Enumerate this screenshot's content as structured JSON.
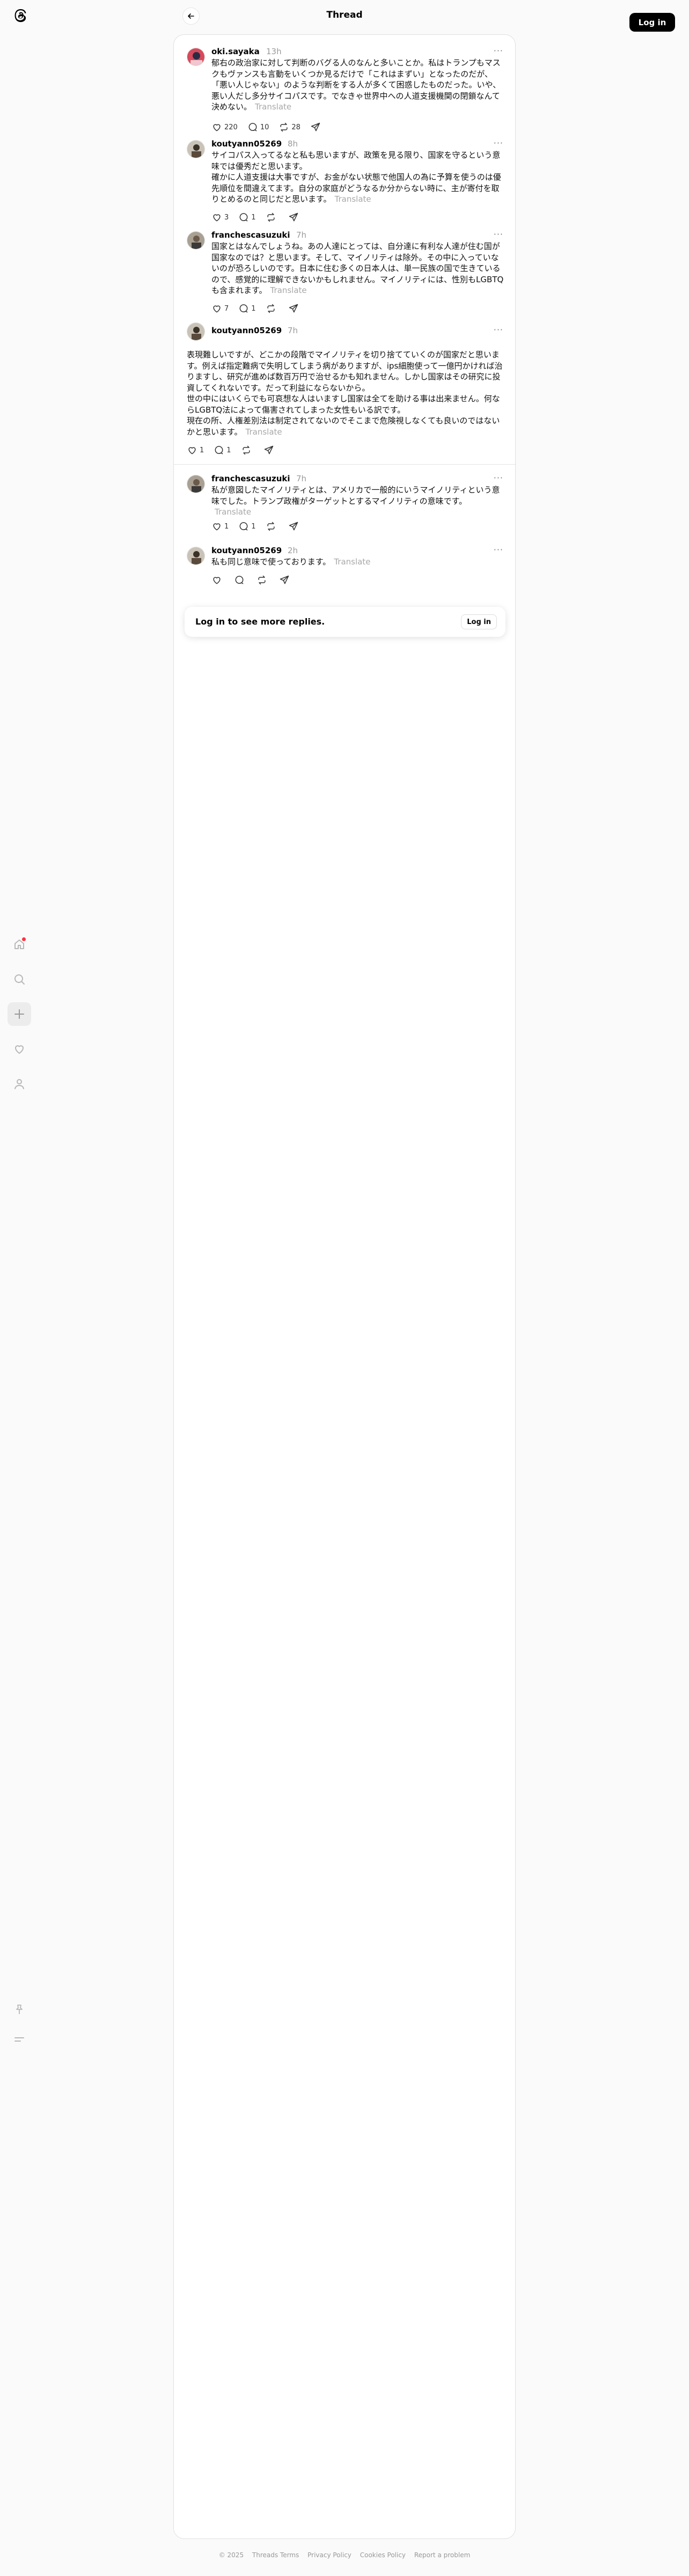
{
  "header": {
    "title": "Thread",
    "login_label": "Log in"
  },
  "nav": {
    "items": [
      {
        "name": "home"
      },
      {
        "name": "search"
      },
      {
        "name": "create"
      },
      {
        "name": "activity"
      },
      {
        "name": "profile"
      }
    ],
    "bottom": [
      {
        "name": "pin"
      },
      {
        "name": "menu"
      }
    ]
  },
  "posts": [
    {
      "username": "oki.sayaka",
      "time": "13h",
      "text": "郁右の政治家に対して判断のバグる人のなんと多いことか。私はトランプもマスクもヴァンスも言動をいくつか見るだけで「これはまずい」となったのだが、「悪い人じゃない」のような判断をする人が多くて困惑したものだった。いや、悪い人だし多分サイコパスです。でなきゃ世界中への人道支援機関の閉鎖なんて決めない。",
      "translate": "Translate",
      "likes": "220",
      "replies": "10",
      "reposts": "28"
    },
    {
      "username": "koutyann05269",
      "time": "8h",
      "text": "サイコパス入ってるなと私も思いますが、政策を見る限り、国家を守るという意味では優秀だと思います。\n確かに人道支援は大事ですが、お金がない状態で他国人の為に予算を使うのは優先順位を間違えてます。自分の家庭がどうなるか分からない時に、主が寄付を取りとめるのと同じだと思います。",
      "translate": "Translate",
      "likes": "3",
      "replies": "1",
      "reposts": ""
    },
    {
      "username": "franchescasuzuki",
      "time": "7h",
      "text": "国家とはなんでしょうね。あの人達にとっては、自分達に有利な人達が住む国が国家なのでは？と思います。そして、マイノリティは除外。その中に入っていないのが恐ろしいのです。日本に住む多くの日本人は、単一民族の国で生きているので、感覚的に理解できないかもしれません。マイノリティには、性別もLGBTQも含まれます。",
      "translate": "Translate",
      "likes": "7",
      "replies": "1",
      "reposts": ""
    },
    {
      "username": "koutyann05269",
      "time": "7h",
      "text": "表現難しいですが、どこかの段階でマイノリティを切り捨てていくのが国家だと思います。例えば指定難病で失明してしまう病がありますが、ips細胞使って一億円かければ治りますし、研究が進めば数百万円で治せるかも知れません。しかし国家はその研究に投資してくれないです。だって利益にならないから。\n世の中にはいくらでも可哀想な人はいますし国家は全てを助ける事は出来ません。何ならLGBTQ法によって傷害されてしまった女性もいる訳です。\n現在の所、人権差別法は制定されてないのでそこまで危険視しなくても良いのではないかと思います。",
      "translate": "Translate",
      "likes": "1",
      "replies": "1",
      "reposts": ""
    },
    {
      "username": "franchescasuzuki",
      "time": "7h",
      "text": "私が意図したマイノリティとは、アメリカで一般的にいうマイノリティという意味でした。トランプ政権がターゲットとするマイノリティの意味です。",
      "translate": "Translate",
      "likes": "1",
      "replies": "1",
      "reposts": ""
    },
    {
      "username": "koutyann05269",
      "time": "2h",
      "text": "私も同じ意味で使っております。",
      "translate": "Translate",
      "likes": "",
      "replies": "",
      "reposts": ""
    }
  ],
  "login_prompt": {
    "text": "Log in to see more replies.",
    "button": "Log in"
  },
  "footer": {
    "items": [
      "© 2025",
      "Threads Terms",
      "Privacy Policy",
      "Cookies Policy",
      "Report a problem"
    ]
  }
}
